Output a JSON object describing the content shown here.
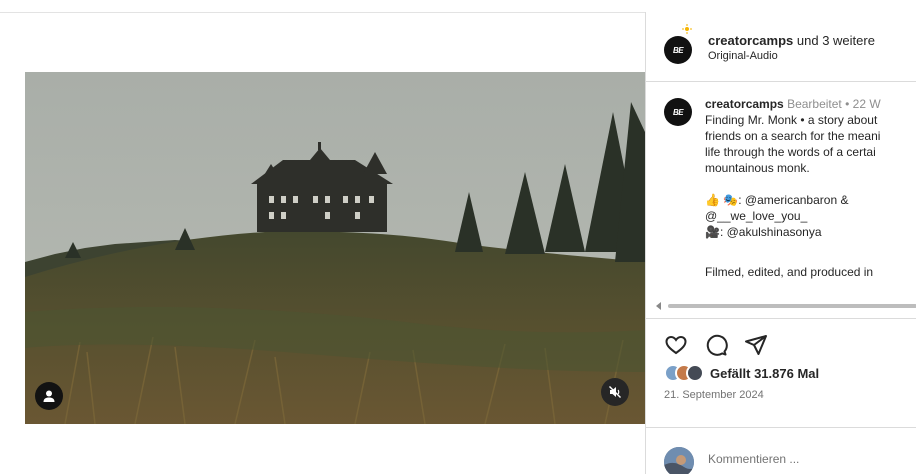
{
  "header": {
    "account": "creatorcamps",
    "collab_suffix": " und 3 weitere",
    "audio": "Original-Audio",
    "logo_text": "BE"
  },
  "caption": {
    "author": "creatorcamps",
    "edited": "Bearbeitet",
    "separator": " • ",
    "age": "22 W",
    "lines": [
      "Finding Mr. Monk • a story about",
      "friends on a search for the meani",
      "life through the words of a certai",
      "mountainous monk."
    ],
    "credits": [
      "👍 🎭: @americanbaron &",
      "@__we_love_you_",
      "🎥: @akulshinasonya"
    ],
    "footer_line": "Filmed, edited, and produced in"
  },
  "actions": {
    "like_icon": "heart-icon",
    "comment_icon": "comment-icon",
    "share_icon": "share-icon"
  },
  "likes": {
    "text": "Gefällt 31.876 Mal"
  },
  "date": "21. September 2024",
  "comment": {
    "placeholder": "Kommentieren ..."
  },
  "video": {
    "user_icon": "user-icon",
    "mute_icon": "muted-speaker-icon"
  },
  "colors": {
    "border": "#dbdbdb",
    "text": "#262626",
    "muted": "#8e8e8e"
  }
}
